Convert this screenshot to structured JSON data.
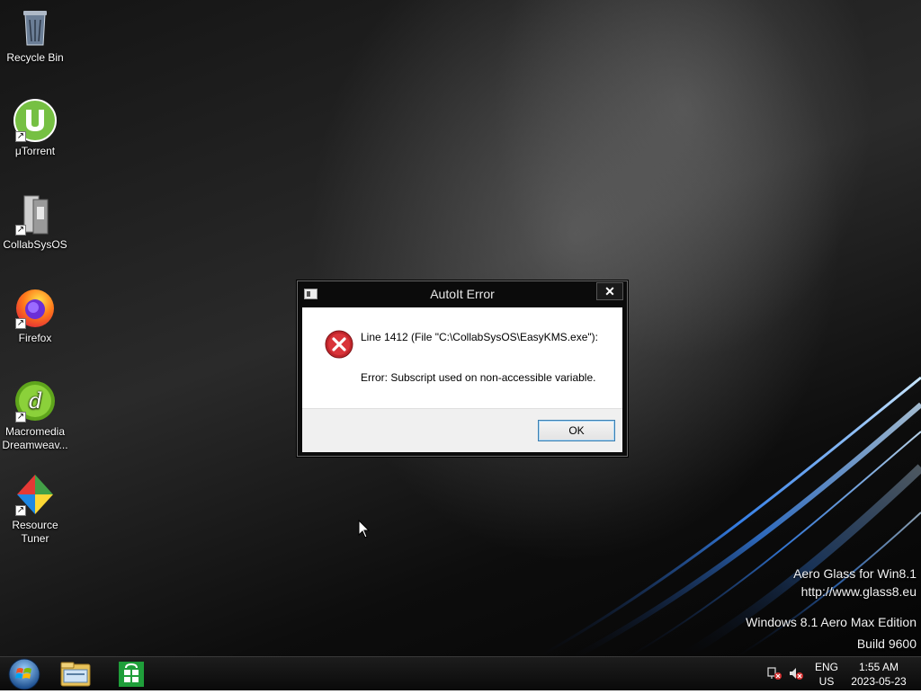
{
  "desktop": {
    "icons": [
      {
        "label": "Recycle Bin",
        "icon": "recycle-bin-icon",
        "shortcut": false
      },
      {
        "label": "μTorrent",
        "icon": "utorrent-icon",
        "shortcut": true
      },
      {
        "label": "CollabSysOS",
        "icon": "collabsysos-icon",
        "shortcut": true
      },
      {
        "label": "Firefox",
        "icon": "firefox-icon",
        "shortcut": true
      },
      {
        "label": "Macromedia Dreamweav...",
        "icon": "dreamweaver-icon",
        "shortcut": true
      },
      {
        "label": "Resource Tuner",
        "icon": "resource-tuner-icon",
        "shortcut": true
      }
    ],
    "watermark": {
      "line1": "Aero Glass for Win8.1",
      "line2": "http://www.glass8.eu",
      "line3": "Windows 8.1 Aero Max Edition",
      "line4": "Build 9600"
    }
  },
  "dialog": {
    "title": "AutoIt Error",
    "close_glyph": "✕",
    "message_line1": "Line 1412  (File \"C:\\CollabSysOS\\EasyKMS.exe\"):",
    "message_line2": "Error: Subscript used on non-accessible variable.",
    "ok_label": "OK",
    "icon": "error-icon"
  },
  "taskbar": {
    "start": "start-icon",
    "apps": [
      "file-explorer-icon",
      "store-icon"
    ],
    "language": {
      "line1": "ENG",
      "line2": "US"
    },
    "clock": {
      "time": "1:55 AM",
      "date": "2023-05-23"
    },
    "tray_icons": [
      "network-error-icon",
      "volume-muted-icon"
    ]
  },
  "colors": {
    "ok_border": "#3c7fb1",
    "error_red": "#c0262c",
    "wallpaper_blue": "#4aa0ff"
  }
}
